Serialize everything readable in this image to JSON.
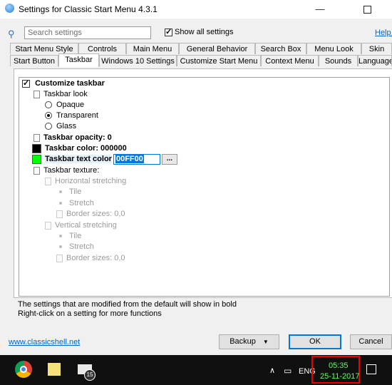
{
  "window": {
    "title": "Settings for Classic Start Menu 4.3.1",
    "minimize_glyph": "—"
  },
  "toolbar": {
    "search_placeholder": "Search settings",
    "show_all_label": "Show all settings",
    "help_label": "Help..."
  },
  "tabs_row1": [
    "Start Menu Style",
    "Controls",
    "Main Menu",
    "General Behavior",
    "Search Box",
    "Menu Look",
    "Skin"
  ],
  "tabs_row2": [
    "Start Button",
    "Taskbar",
    "Windows 10 Settings",
    "Customize Start Menu",
    "Context Menu",
    "Sounds",
    "Language"
  ],
  "active_tab": "Taskbar",
  "tree": {
    "customize_taskbar": "Customize taskbar",
    "taskbar_look": "Taskbar look",
    "opaque": "Opaque",
    "transparent": "Transparent",
    "glass": "Glass",
    "opacity": "Taskbar opacity: 0",
    "color": "Taskbar color: 000000",
    "text_color_label": "Taskbar text color",
    "text_color_value": "00FF00",
    "browse_label": "...",
    "texture": "Taskbar texture:",
    "h_stretch": "Horizontal stretching",
    "tile1": "Tile",
    "stretch1": "Stretch",
    "border1": "Border sizes: 0,0",
    "v_stretch": "Vertical stretching",
    "tile2": "Tile",
    "stretch2": "Stretch",
    "border2": "Border sizes: 0,0"
  },
  "colors": {
    "taskbar_color": "#000000",
    "text_color": "#00ff00",
    "accent": "#0078d7"
  },
  "info": {
    "line1": "The settings that are modified from the default will show in bold",
    "line2": "Right-click on a setting for more functions"
  },
  "footer": {
    "website": "www.classicshell.net",
    "backup_label": "Backup",
    "ok_label": "OK",
    "cancel_label": "Cancel"
  },
  "taskbar": {
    "mail_badge": "15",
    "tray_up": "∧",
    "lang": "ENG",
    "time": "05:35",
    "date": "25-11-2017"
  }
}
